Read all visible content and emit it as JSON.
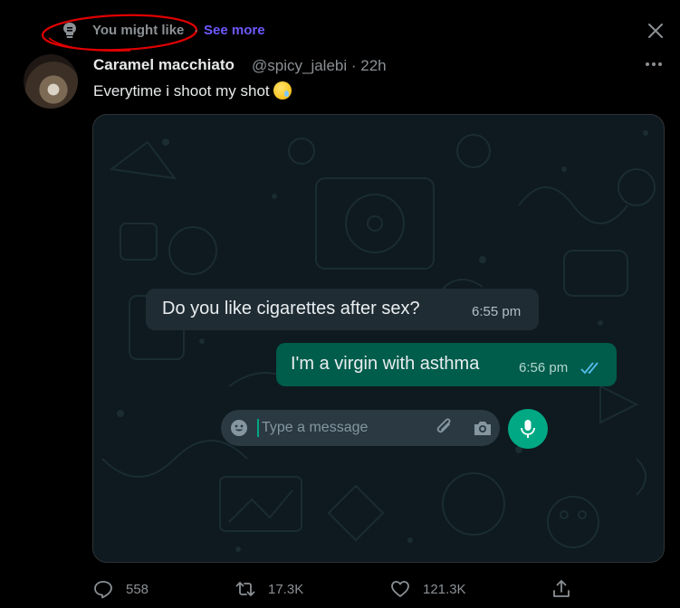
{
  "header": {
    "label": "You might like",
    "separator": "·",
    "see_more": "See more"
  },
  "tweet": {
    "display_name": "Caramel macchiato",
    "handle_time": "@spicy_jalebi · 22h",
    "text": "Everytime i shoot my shot",
    "emoji": "face-holding-back-tears"
  },
  "chat": {
    "incoming_text": "Do you like cigarettes after sex?",
    "incoming_time": "6:55 pm",
    "outgoing_text": "I'm a virgin with asthma",
    "outgoing_time": "6:56 pm",
    "input_placeholder": "Type a message"
  },
  "actions": {
    "replies": "558",
    "retweets": "17.3K",
    "likes": "121.3K"
  },
  "colors": {
    "accent": "#6e59ff",
    "whatsapp_green": "#00a884",
    "outgoing_bubble": "#005c4b",
    "incoming_bubble": "#1f2c34",
    "annotation_circle": "#e00000"
  }
}
